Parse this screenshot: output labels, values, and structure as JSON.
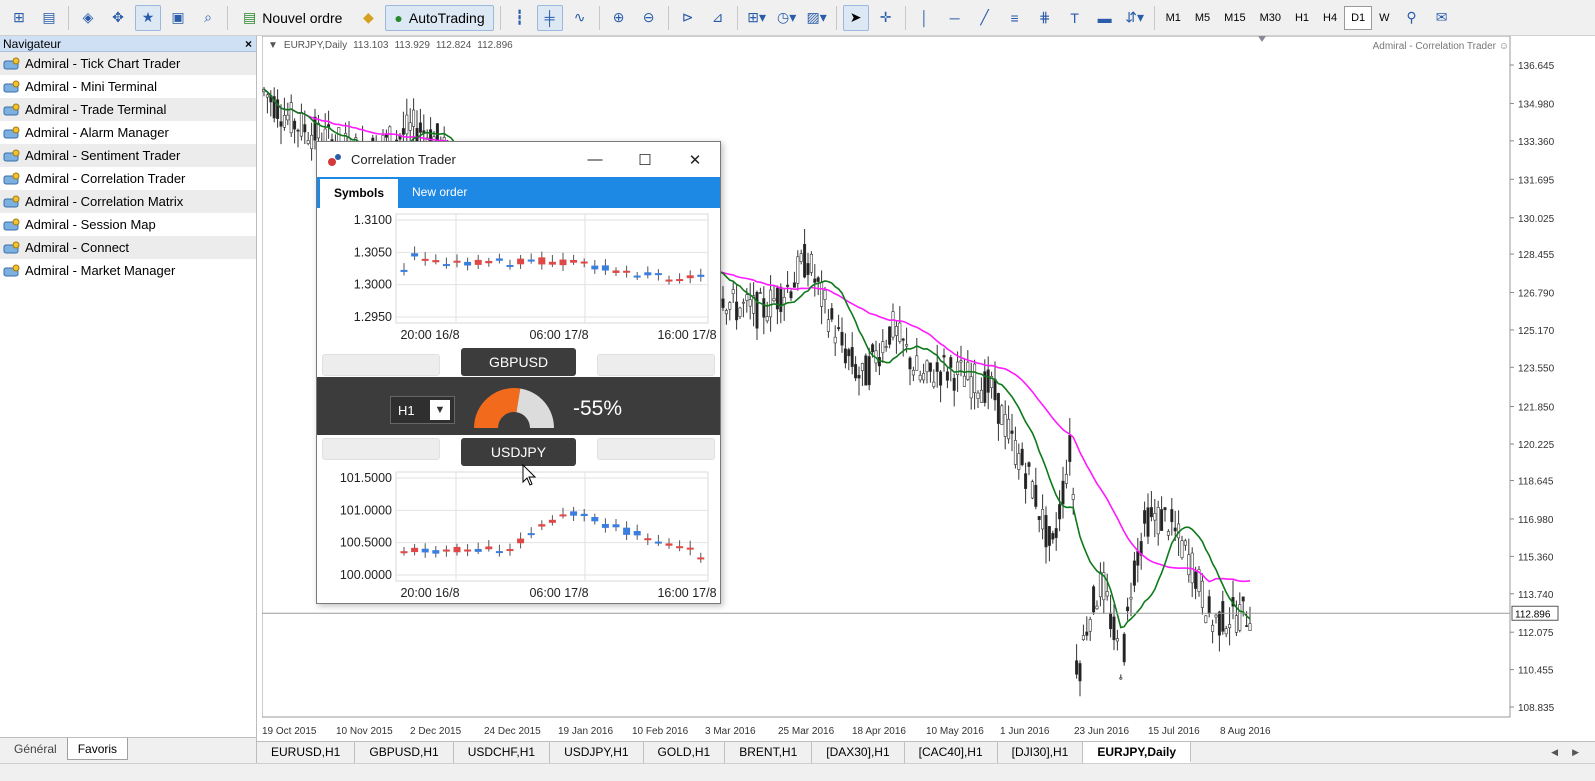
{
  "toolbar": {
    "new_order_label": "Nouvel ordre",
    "autotrading_label": "AutoTrading",
    "timeframes": [
      "M1",
      "M5",
      "M15",
      "M30",
      "H1",
      "H4",
      "D1",
      "W"
    ],
    "active_timeframe": "D1"
  },
  "navigator": {
    "title": "Navigateur",
    "close": "×",
    "items": [
      "Admiral - Tick Chart Trader",
      "Admiral - Mini Terminal",
      "Admiral - Trade Terminal",
      "Admiral - Alarm Manager",
      "Admiral - Sentiment Trader",
      "Admiral - Correlation Trader",
      "Admiral - Correlation Matrix",
      "Admiral - Session Map",
      "Admiral - Connect",
      "Admiral - Market Manager"
    ],
    "tabs": [
      "Général",
      "Favoris"
    ],
    "active_tab": "Favoris"
  },
  "main_chart": {
    "symbol_label": "EURJPY,Daily",
    "ohlc": [
      "113.103",
      "113.929",
      "112.824",
      "112.896"
    ],
    "ea_label": "Admiral - Correlation Trader",
    "price_ticks": [
      "136.645",
      "134.980",
      "133.360",
      "131.695",
      "130.025",
      "128.455",
      "126.790",
      "125.170",
      "123.550",
      "121.850",
      "120.225",
      "118.645",
      "116.980",
      "115.360",
      "113.740",
      "112.075",
      "110.455",
      "108.835"
    ],
    "current_price": "112.896",
    "date_ticks": [
      "19 Oct 2015",
      "10 Nov 2015",
      "2 Dec 2015",
      "24 Dec 2015",
      "19 Jan 2016",
      "10 Feb 2016",
      "3 Mar 2016",
      "25 Mar 2016",
      "18 Apr 2016",
      "10 May 2016",
      "1 Jun 2016",
      "23 Jun 2016",
      "15 Jul 2016",
      "8 Aug 2016"
    ]
  },
  "symbol_tabs": [
    "EURUSD,H1",
    "GBPUSD,H1",
    "USDCHF,H1",
    "USDJPY,H1",
    "GOLD,H1",
    "BRENT,H1",
    "[DAX30],H1",
    "[CAC40],H1",
    "[DJI30],H1",
    "EURJPY,Daily"
  ],
  "active_symbol_tab": "EURJPY,Daily",
  "correlation_trader": {
    "title": "Correlation Trader",
    "tabs": [
      "Symbols",
      "New order"
    ],
    "active_tab": "Symbols",
    "symbol1": "GBPUSD",
    "symbol2": "USDJPY",
    "timeframe": "H1",
    "correlation": "-55%",
    "correlation_value": -55,
    "chart1": {
      "y_ticks": [
        "1.3100",
        "1.3050",
        "1.3000",
        "1.2950"
      ],
      "x_ticks": [
        "20:00 16/8",
        "06:00 17/8",
        "16:00 17/8"
      ]
    },
    "chart2": {
      "y_ticks": [
        "101.5000",
        "101.0000",
        "100.5000",
        "100.0000"
      ],
      "x_ticks": [
        "20:00 16/8",
        "06:00 17/8",
        "16:00 17/8"
      ]
    }
  },
  "colors": {
    "accent": "#1e88e5",
    "gauge": "#f26b1d",
    "bull": "#3a7fe0",
    "bear": "#e04848",
    "ma_fast": "#0e7a1a",
    "ma_slow": "#ff1aff"
  }
}
